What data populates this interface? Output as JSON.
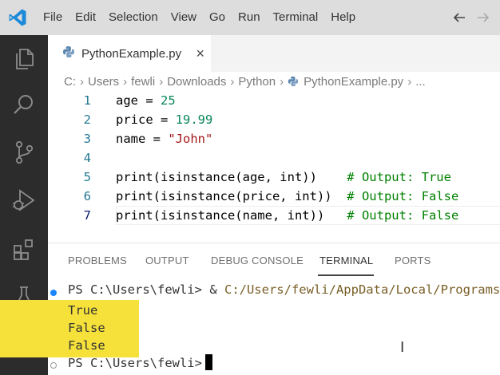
{
  "app": {
    "logo_icon": "vscode-logo-icon",
    "accent": "#007acc"
  },
  "menu": [
    "File",
    "Edit",
    "Selection",
    "View",
    "Go",
    "Run",
    "Terminal",
    "Help"
  ],
  "activity_bar": [
    "explorer-icon",
    "search-icon",
    "source-control-icon",
    "run-debug-icon",
    "extensions-icon",
    "testing-icon"
  ],
  "tab": {
    "label": "PythonExample.py",
    "close": "×"
  },
  "breadcrumb": [
    "C:",
    "Users",
    "fewli",
    "Downloads",
    "Python",
    "PythonExample.py",
    "..."
  ],
  "editor": {
    "line_numbers": [
      "1",
      "2",
      "3",
      "4",
      "5",
      "6",
      "7"
    ],
    "lines": [
      {
        "parts": [
          {
            "t": "age = ",
            "c": ""
          },
          {
            "t": "25",
            "c": "num"
          }
        ]
      },
      {
        "parts": [
          {
            "t": "price = ",
            "c": ""
          },
          {
            "t": "19.99",
            "c": "num"
          }
        ]
      },
      {
        "parts": [
          {
            "t": "name = ",
            "c": ""
          },
          {
            "t": "\"John\"",
            "c": "str"
          }
        ]
      },
      {
        "parts": []
      },
      {
        "parts": [
          {
            "t": "print(isinstance(age, int))    ",
            "c": ""
          },
          {
            "t": "# Output: True",
            "c": "cmt"
          }
        ]
      },
      {
        "parts": [
          {
            "t": "print(isinstance(price, int))  ",
            "c": ""
          },
          {
            "t": "# Output: False",
            "c": "cmt"
          }
        ]
      },
      {
        "parts": [
          {
            "t": "print(isinstance(name, int))   ",
            "c": ""
          },
          {
            "t": "# Output: False",
            "c": "cmt"
          }
        ]
      }
    ]
  },
  "panel": {
    "tabs": [
      "PROBLEMS",
      "OUTPUT",
      "DEBUG CONSOLE",
      "TERMINAL",
      "PORTS"
    ],
    "active_tab": "TERMINAL"
  },
  "terminal": {
    "prompt1": "PS C:\\Users\\fewli> ",
    "cmd_amp": "& ",
    "cmd_path": "C:/Users/fewli/AppData/Local/Programs/P",
    "outputs": [
      "True",
      "False",
      "False"
    ],
    "prompt2": "PS C:\\Users\\fewli> "
  }
}
